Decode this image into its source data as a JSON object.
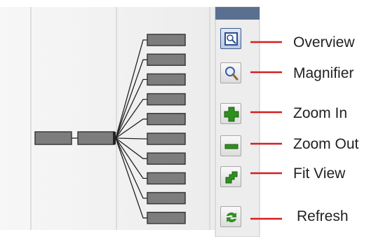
{
  "toolbar": {
    "buttons": [
      {
        "id": "overview",
        "label": "Overview",
        "icon": "overview-icon",
        "active": true
      },
      {
        "id": "magnifier",
        "label": "Magnifier",
        "icon": "magnifier-icon",
        "active": false
      },
      {
        "id": "zoom_in",
        "label": "Zoom In",
        "icon": "zoom-in-icon",
        "active": false
      },
      {
        "id": "zoom_out",
        "label": "Zoom Out",
        "icon": "zoom-out-icon",
        "active": false
      },
      {
        "id": "fit_view",
        "label": "Fit View",
        "icon": "fit-view-icon",
        "active": false
      },
      {
        "id": "refresh",
        "label": "Refresh",
        "icon": "refresh-icon",
        "active": false
      }
    ]
  },
  "diagram": {
    "root_nodes": 2,
    "child_nodes": 10
  },
  "colors": {
    "node_fill": "#7d7d7d",
    "node_stroke": "#3a3a3a",
    "toolbar_header": "#5a7090",
    "icon_green": "#2f8f1f",
    "icon_blue": "#3a5fa8",
    "callout_line": "#d42020"
  }
}
